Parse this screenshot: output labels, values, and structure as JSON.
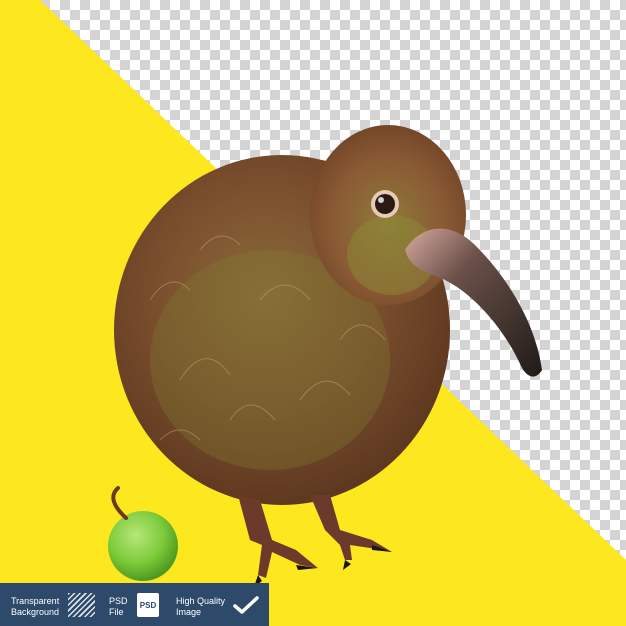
{
  "image": {
    "subject": "kiwi-bird",
    "background_colors": {
      "yellow": "#fde81f",
      "checker_light": "#ffffff",
      "checker_dark": "#d4d4d4"
    },
    "bird_colors": {
      "body": "#7a4e2d",
      "head": "#8a5a34",
      "beak": "#3d2e28",
      "feet": "#6b3a2a"
    },
    "fruit_color": "#7ecb3a"
  },
  "badges": {
    "transparent_line1": "Transparent",
    "transparent_line2": "Background",
    "psd_line1": "PSD",
    "psd_line2": "File",
    "psd_icon_text": "PSD",
    "quality_line1": "High Quality",
    "quality_line2": "Image",
    "bar_color": "#2e4a6b"
  }
}
